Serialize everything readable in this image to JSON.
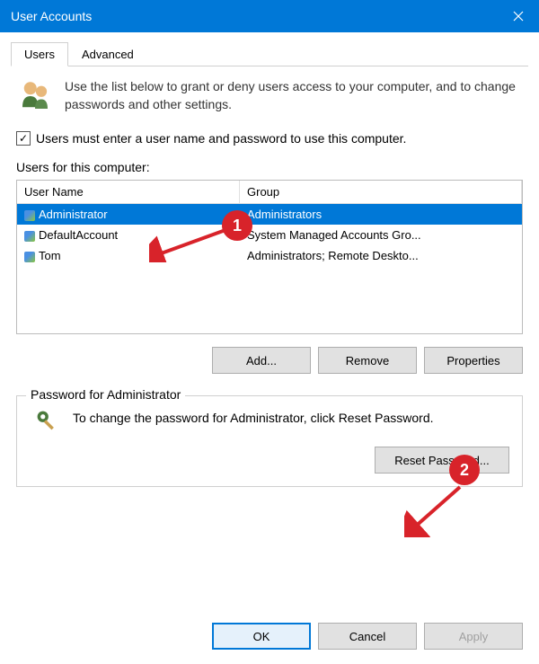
{
  "titlebar": {
    "title": "User Accounts"
  },
  "tabs": {
    "users": "Users",
    "advanced": "Advanced"
  },
  "intro": "Use the list below to grant or deny users access to your computer, and to change passwords and other settings.",
  "checkbox_label": "Users must enter a user name and password to use this computer.",
  "list_label": "Users for this computer:",
  "columns": {
    "name": "User Name",
    "group": "Group"
  },
  "users": [
    {
      "name": "Administrator",
      "group": "Administrators",
      "selected": true
    },
    {
      "name": "DefaultAccount",
      "group": "System Managed Accounts Gro...",
      "selected": false
    },
    {
      "name": "Tom",
      "group": "Administrators; Remote Deskto...",
      "selected": false
    }
  ],
  "buttons": {
    "add": "Add...",
    "remove": "Remove",
    "properties": "Properties",
    "reset": "Reset Password...",
    "ok": "OK",
    "cancel": "Cancel",
    "apply": "Apply"
  },
  "password_section": {
    "legend": "Password for Administrator",
    "text": "To change the password for Administrator, click Reset Password."
  },
  "annotations": {
    "one": "1",
    "two": "2"
  }
}
